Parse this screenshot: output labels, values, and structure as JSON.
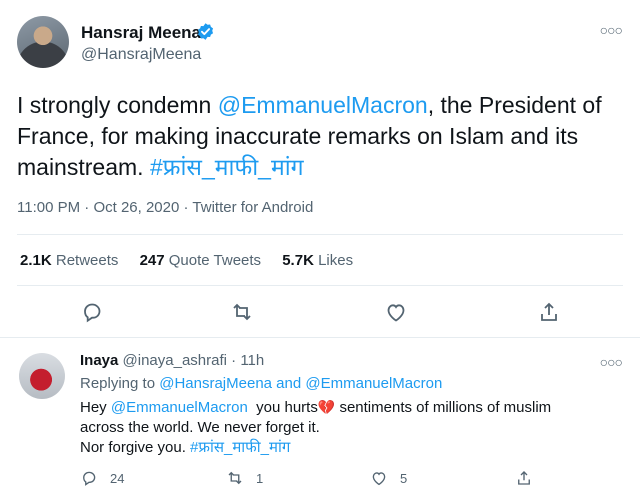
{
  "main_tweet": {
    "author_name": "Hansraj Meena",
    "handle": "@HansrajMeena",
    "text_before": "I strongly condemn ",
    "mention": "@EmmanuelMacron",
    "text_after": ", the President of France, for making inaccurate remarks on Islam and its mainstream. ",
    "hashtag": "#फ्रांस_माफी_मांग",
    "time": "11:00 PM",
    "date": "Oct 26, 2020",
    "source": "Twitter for Android",
    "stats": {
      "retweets_count": "2.1K",
      "retweets_label": "Retweets",
      "quote_count": "247",
      "quote_label": "Quote Tweets",
      "likes_count": "5.7K",
      "likes_label": "Likes"
    }
  },
  "reply": {
    "author_name": "Inaya",
    "handle": "@inaya_ashrafi",
    "age": "11h",
    "replying_to_label": "Replying to",
    "replying_to_user1": "@HansrajMeena",
    "replying_and": "and",
    "replying_to_user2": "@EmmanuelMacron",
    "line1_before": "Hey ",
    "line1_mention": "@EmmanuelMacron",
    "line1_after_mention": "  you hurts",
    "line1_after_emoji": " sentiments of millions of muslim",
    "line2": "across the world. We never forget it.",
    "line3_before": "Nor forgive you. ",
    "line3_hashtag": "#फ्रांस_माफी_मांग",
    "reply_count": "24",
    "retweet_count": "1",
    "like_count": "5"
  },
  "icons": {
    "verified": "verified-badge-icon",
    "more": "more-options-icon",
    "reply": "reply-icon",
    "retweet": "retweet-icon",
    "like": "heart-icon",
    "share": "share-icon",
    "broken_heart": "broken-heart-emoji"
  },
  "colors": {
    "accent": "#1d9bf0",
    "text": "#0f1419",
    "secondary": "#536471",
    "divider": "#e6ecf0"
  }
}
